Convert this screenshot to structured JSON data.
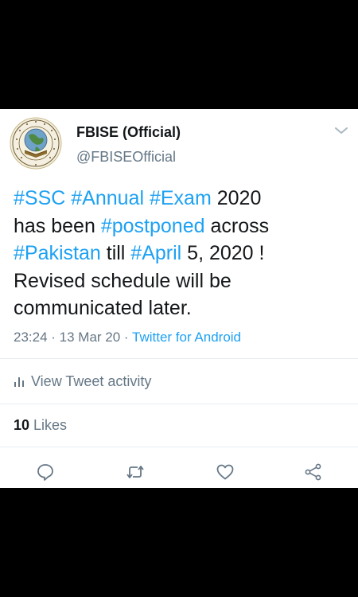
{
  "tweet": {
    "author": {
      "display_name": "FBISE (Official)",
      "handle": "@FBISEOfficial",
      "avatar_icon": "fbise-logo-icon"
    },
    "text_lines": [
      [
        {
          "t": "#SSC",
          "tag": true
        },
        {
          "t": " ",
          "tag": false
        },
        {
          "t": "#Annual",
          "tag": true
        },
        {
          "t": " ",
          "tag": false
        },
        {
          "t": "#Exam",
          "tag": true
        },
        {
          "t": " 2020",
          "tag": false
        }
      ],
      [
        {
          "t": "has been ",
          "tag": false
        },
        {
          "t": "#postponed",
          "tag": true
        },
        {
          "t": " across",
          "tag": false
        }
      ],
      [
        {
          "t": "#Pakistan",
          "tag": true
        },
        {
          "t": " till ",
          "tag": false
        },
        {
          "t": "#April",
          "tag": true
        },
        {
          "t": " 5, 2020 !",
          "tag": false
        }
      ],
      [
        {
          "t": "Revised schedule will be",
          "tag": false
        }
      ],
      [
        {
          "t": "communicated later.",
          "tag": false
        }
      ]
    ],
    "timestamp": "23:24 · 13 Mar 20 · ",
    "source": "Twitter for Android",
    "activity_label": "View Tweet activity",
    "likes_count": "10",
    "likes_label": " Likes"
  },
  "colors": {
    "link": "#1da1f2",
    "secondary": "#657786",
    "primary": "#14171a",
    "divider": "#e6ecf0"
  },
  "icons": {
    "more": "chevron-down-icon",
    "activity": "bar-chart-icon",
    "reply": "reply-icon",
    "retweet": "retweet-icon",
    "like": "heart-icon",
    "share": "share-icon"
  }
}
